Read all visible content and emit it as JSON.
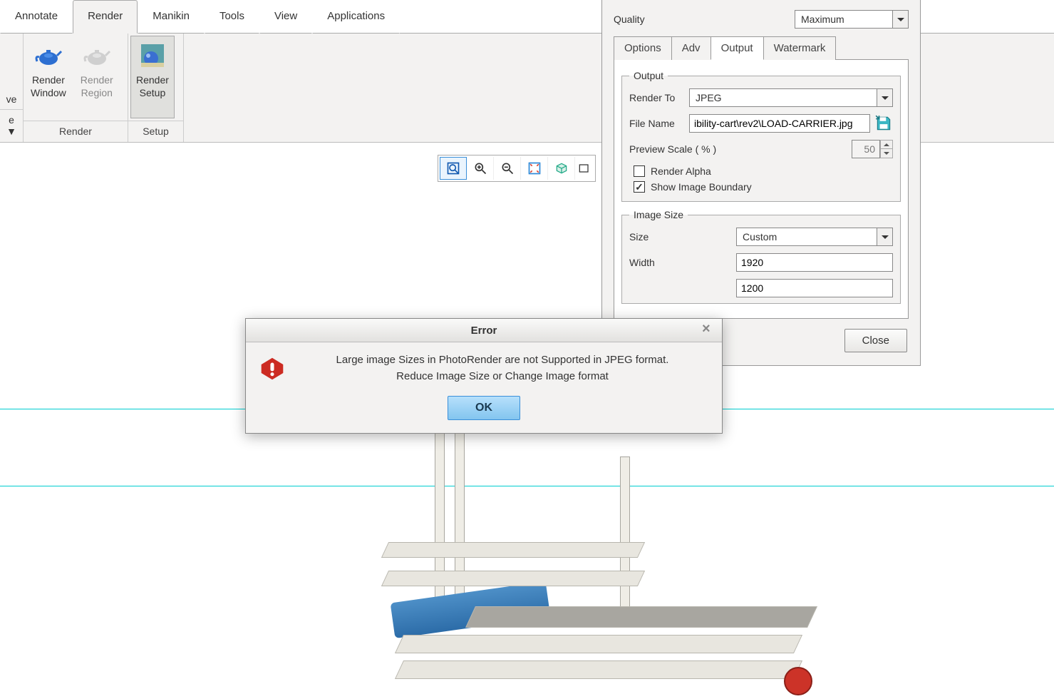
{
  "ribbonTabs": {
    "annotate": "Annotate",
    "render": "Render",
    "manikin": "Manikin",
    "tools": "Tools",
    "view": "View",
    "applications": "Applications"
  },
  "ribbon": {
    "leftPartial": "ve",
    "renderWindow": "Render\nWindow",
    "renderRegion": "Render\nRegion",
    "renderSetup": "Render\nSetup",
    "groupRender": "Render",
    "groupSetup": "Setup",
    "dropdownMarker": "e ▼"
  },
  "quality": {
    "label": "Quality",
    "value": "Maximum"
  },
  "subtabs": {
    "options": "Options",
    "adv": "Adv",
    "output": "Output",
    "watermark": "Watermark"
  },
  "output": {
    "legend": "Output",
    "renderToLabel": "Render To",
    "renderToValue": "JPEG",
    "fileNameLabel": "File Name",
    "fileNameValue": "ibility-cart\\rev2\\LOAD-CARRIER.jpg",
    "previewScaleLabel": "Preview Scale ( % )",
    "previewScaleValue": "50",
    "renderAlpha": "Render Alpha",
    "showBoundary": "Show Image Boundary"
  },
  "imageSize": {
    "legend": "Image Size",
    "sizeLabel": "Size",
    "sizeValue": "Custom",
    "widthLabel": "Width",
    "widthValue": "1920",
    "heightValue": "1200"
  },
  "panel": {
    "close": "Close"
  },
  "error": {
    "title": "Error",
    "line1": "Large image Sizes in PhotoRender are not Supported in JPEG format.",
    "line2": "Reduce Image Size or Change Image format",
    "ok": "OK"
  }
}
